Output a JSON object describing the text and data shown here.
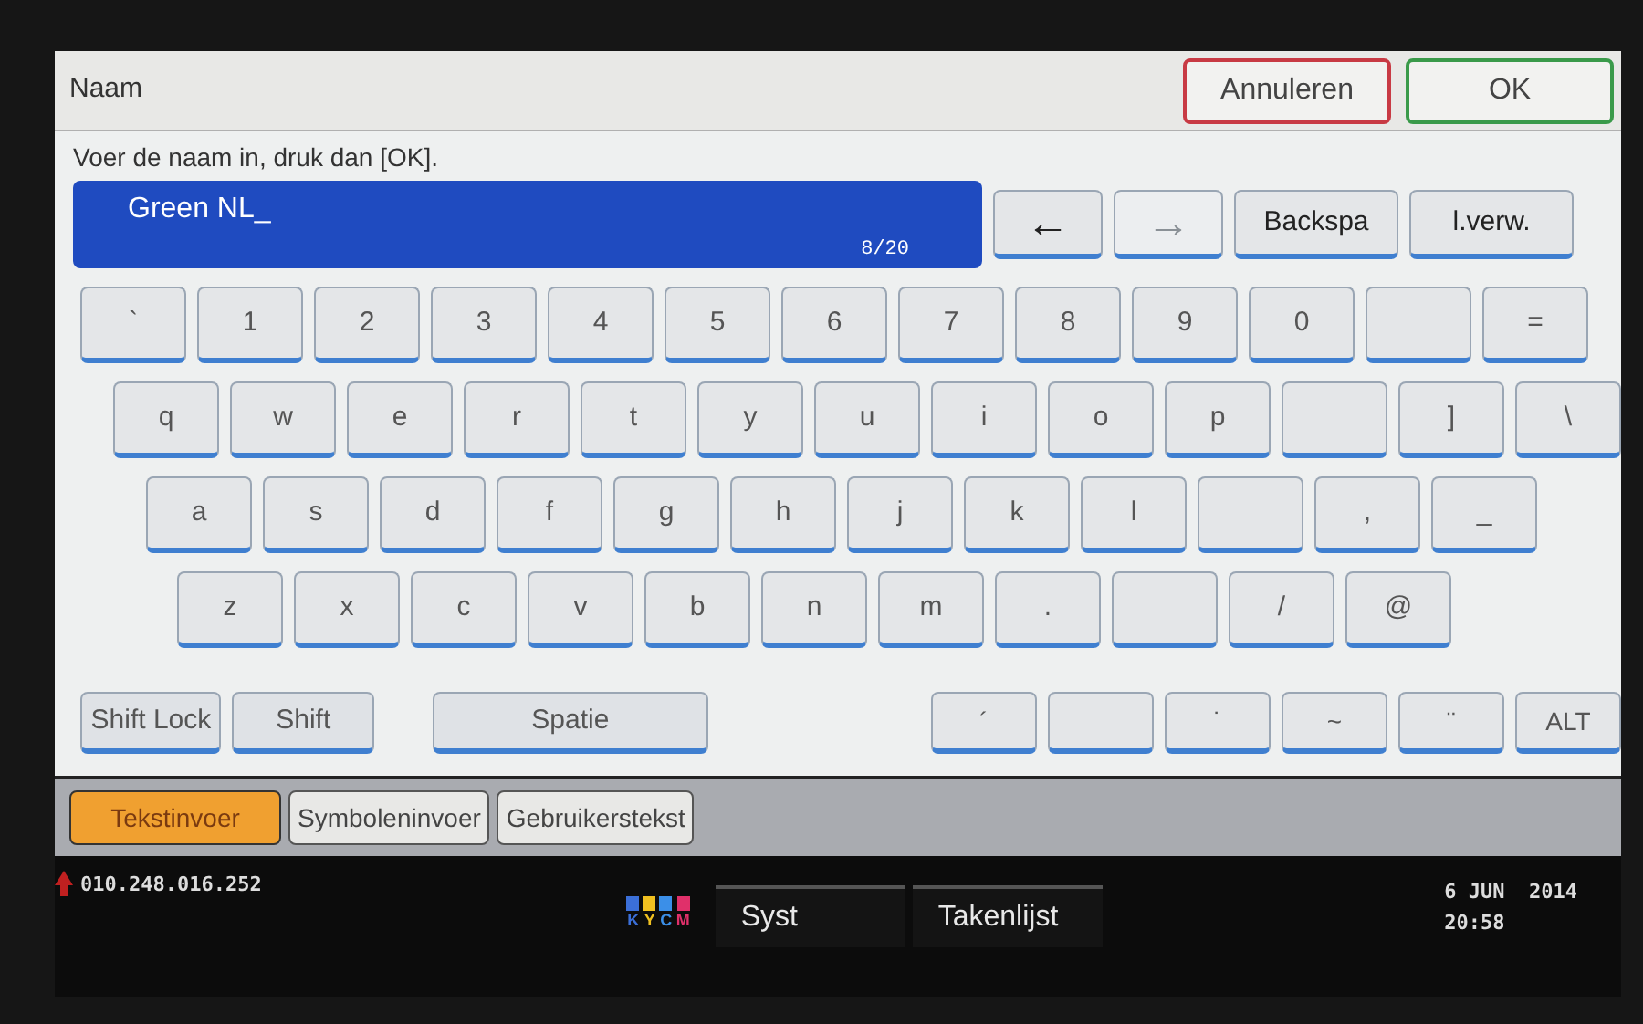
{
  "header": {
    "title": "Naam",
    "buttons": [
      {
        "label": "Annuleren",
        "kind": "cancel"
      },
      {
        "label": "OK",
        "kind": "ok"
      }
    ]
  },
  "instruction": "Voer de naam in, druk dan [OK].",
  "input": {
    "value": "Green NL_",
    "counter": "8/20"
  },
  "edit_buttons": [
    {
      "label": "←",
      "disabled": false
    },
    {
      "label": "→",
      "disabled": true
    },
    {
      "label": "Backspa",
      "disabled": false
    },
    {
      "label": "l.verw.",
      "disabled": false
    }
  ],
  "key_rows": [
    [
      {
        "kind": "key",
        "label": "`"
      },
      {
        "kind": "key",
        "label": "1"
      },
      {
        "kind": "key",
        "label": "2"
      },
      {
        "kind": "key",
        "label": "3"
      },
      {
        "kind": "key",
        "label": "4"
      },
      {
        "kind": "key",
        "label": "5"
      },
      {
        "kind": "key",
        "label": "6"
      },
      {
        "kind": "key",
        "label": "7"
      },
      {
        "kind": "key",
        "label": "8"
      },
      {
        "kind": "key",
        "label": "9"
      },
      {
        "kind": "key",
        "label": "0"
      },
      {
        "kind": "hidden"
      },
      {
        "kind": "key",
        "label": "="
      }
    ],
    [
      {
        "kind": "key",
        "label": "q"
      },
      {
        "kind": "key",
        "label": "w"
      },
      {
        "kind": "key",
        "label": "e"
      },
      {
        "kind": "key",
        "label": "r"
      },
      {
        "kind": "key",
        "label": "t"
      },
      {
        "kind": "key",
        "label": "y"
      },
      {
        "kind": "key",
        "label": "u"
      },
      {
        "kind": "key",
        "label": "i"
      },
      {
        "kind": "key",
        "label": "o"
      },
      {
        "kind": "key",
        "label": "p"
      },
      {
        "kind": "hidden"
      },
      {
        "kind": "key",
        "label": "]"
      },
      {
        "kind": "key",
        "label": "\\"
      }
    ],
    [
      {
        "kind": "key",
        "label": "a"
      },
      {
        "kind": "key",
        "label": "s"
      },
      {
        "kind": "key",
        "label": "d"
      },
      {
        "kind": "key",
        "label": "f"
      },
      {
        "kind": "key",
        "label": "g"
      },
      {
        "kind": "key",
        "label": "h"
      },
      {
        "kind": "key",
        "label": "j"
      },
      {
        "kind": "key",
        "label": "k"
      },
      {
        "kind": "key",
        "label": "l"
      },
      {
        "kind": "hidden"
      },
      {
        "kind": "key",
        "label": ","
      },
      {
        "kind": "key",
        "label": "_"
      }
    ],
    [
      {
        "kind": "key",
        "label": "z"
      },
      {
        "kind": "key",
        "label": "x"
      },
      {
        "kind": "key",
        "label": "c"
      },
      {
        "kind": "key",
        "label": "v"
      },
      {
        "kind": "key",
        "label": "b"
      },
      {
        "kind": "key",
        "label": "n"
      },
      {
        "kind": "key",
        "label": "m"
      },
      {
        "kind": "key",
        "label": "."
      },
      {
        "kind": "hidden"
      },
      {
        "kind": "key",
        "label": "/"
      },
      {
        "kind": "key",
        "label": "@"
      }
    ]
  ],
  "function_keys": [
    {
      "kind": "shiftlock",
      "label": "Shift Lock"
    },
    {
      "kind": "shift",
      "label": "Shift"
    },
    {
      "kind": "space",
      "label": "Spatie"
    }
  ],
  "accent_keys": [
    {
      "kind": "key",
      "label": "´"
    },
    {
      "kind": "hidden"
    },
    {
      "kind": "key",
      "label": "˙"
    },
    {
      "kind": "key",
      "label": "~"
    },
    {
      "kind": "key",
      "label": "¨"
    },
    {
      "kind": "key",
      "label": "ALT"
    }
  ],
  "tabs": [
    {
      "label": "Tekstinvoer",
      "selected": true
    },
    {
      "label": "Symboleninvoer",
      "selected": false
    },
    {
      "label": "Gebruikerstekst",
      "selected": false
    }
  ],
  "status_bar": {
    "ip": "010.248.016.252",
    "toner": [
      {
        "label": "K",
        "color": "#3b6fd8"
      },
      {
        "label": "Y",
        "color": "#f0c020"
      },
      {
        "label": "C",
        "color": "#3b8fe8"
      },
      {
        "label": "M",
        "color": "#e0306a"
      }
    ],
    "buttons": [
      "Syst",
      "Takenlijst"
    ],
    "date": "6 JUN  2014",
    "time": "20:58"
  }
}
